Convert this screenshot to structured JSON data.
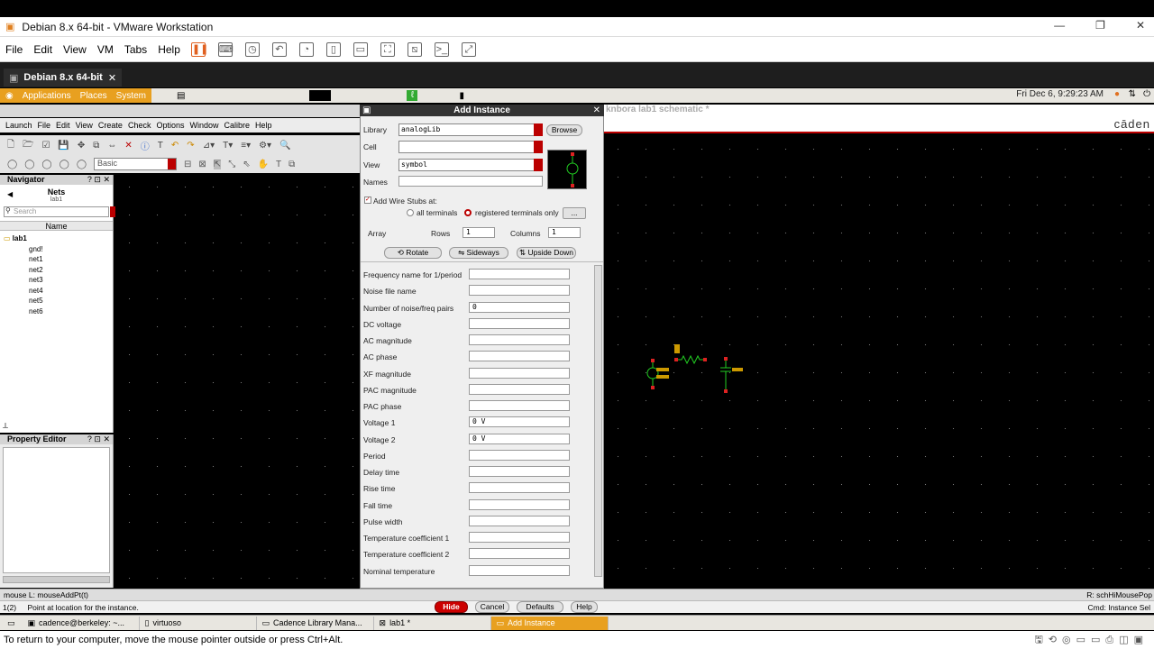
{
  "vm": {
    "title": "Debian 8.x 64-bit - VMware Workstation",
    "menu": [
      "File",
      "Edit",
      "View",
      "VM",
      "Tabs",
      "Help"
    ],
    "tab_label": "Debian 8.x 64-bit",
    "bottom_hint": "To return to your computer, move the mouse pointer outside or press Ctrl+Alt."
  },
  "gnome": {
    "menus": [
      "Applications",
      "Places",
      "System"
    ],
    "clock": "Fri Dec  6,  9:29:23 AM"
  },
  "virtuoso": {
    "menu": [
      "Launch",
      "File",
      "Edit",
      "View",
      "Create",
      "Check",
      "Options",
      "Window",
      "Calibre",
      "Help"
    ],
    "filter_value": "Basic",
    "schematic_title": "knbora lab1 schematic *",
    "logo": "cāden"
  },
  "navigator": {
    "title": "Navigator",
    "controls": "? ⊡ ✕",
    "mode": "Nets",
    "cell": "lab1",
    "search_placeholder": "Search",
    "column": "Name",
    "root": "lab1",
    "nets": [
      "gnd!",
      "net1",
      "net2",
      "net3",
      "net4",
      "net5",
      "net6"
    ]
  },
  "property_editor": {
    "title": "Property Editor",
    "controls": "? ⊡ ✕"
  },
  "dialog": {
    "title": "Add Instance",
    "library_label": "Library",
    "library_value": "analogLib",
    "browse": "Browse",
    "cell_label": "Cell",
    "cell_value": "",
    "view_label": "View",
    "view_value": "symbol",
    "names_label": "Names",
    "wire_stubs": "Add Wire Stubs at:",
    "all_terminals": "all terminals",
    "registered_terminals": "registered terminals only",
    "more": "...",
    "array": "Array",
    "rows_label": "Rows",
    "rows_value": "1",
    "columns_label": "Columns",
    "columns_value": "1",
    "rotate": "Rotate",
    "sideways": "Sideways",
    "upside_down": "Upside Down",
    "params": [
      {
        "label": "Frequency name for 1/period",
        "value": ""
      },
      {
        "label": "Noise file name",
        "value": ""
      },
      {
        "label": "Number of noise/freq pairs",
        "value": "0"
      },
      {
        "label": "DC voltage",
        "value": ""
      },
      {
        "label": "AC magnitude",
        "value": ""
      },
      {
        "label": "AC phase",
        "value": ""
      },
      {
        "label": "XF magnitude",
        "value": ""
      },
      {
        "label": "PAC magnitude",
        "value": ""
      },
      {
        "label": "PAC phase",
        "value": ""
      },
      {
        "label": "Voltage 1",
        "value": "0 V"
      },
      {
        "label": "Voltage 2",
        "value": "0 V"
      },
      {
        "label": "Period",
        "value": ""
      },
      {
        "label": "Delay time",
        "value": ""
      },
      {
        "label": "Rise time",
        "value": ""
      },
      {
        "label": "Fall time",
        "value": ""
      },
      {
        "label": "Pulse width",
        "value": ""
      },
      {
        "label": "Temperature coefficient 1",
        "value": ""
      },
      {
        "label": "Temperature coefficient 2",
        "value": ""
      },
      {
        "label": "Nominal temperature",
        "value": ""
      }
    ],
    "hide": "Hide",
    "cancel": "Cancel",
    "defaults": "Defaults",
    "help": "Help"
  },
  "status": {
    "mouse": "mouse L: mouseAddPt(t)",
    "mouse_right": "R: schHiMousePop",
    "prompt_num": "1(2)",
    "prompt": "Point at location for the instance.",
    "cmd": "Cmd: Instance   Sel"
  },
  "taskbar": [
    {
      "label": "cadence@berkeley: ~...",
      "active": false
    },
    {
      "label": "virtuoso",
      "active": false
    },
    {
      "label": "Cadence Library Mana...",
      "active": false
    },
    {
      "label": "lab1 *",
      "active": false
    },
    {
      "label": "Add Instance",
      "active": true
    }
  ]
}
